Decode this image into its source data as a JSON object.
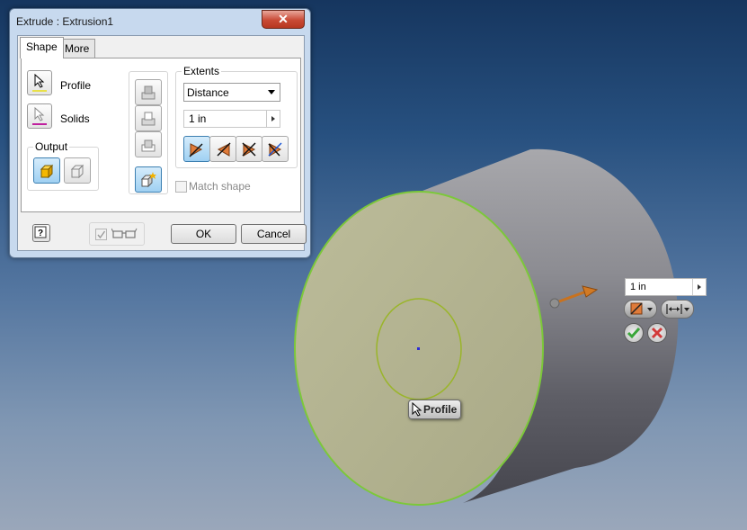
{
  "dialog": {
    "title": "Extrude : Extrusion1",
    "close_glyph": "✕",
    "tabs": [
      {
        "label": "Shape",
        "active": true
      },
      {
        "label": "More",
        "active": false
      }
    ],
    "profile_label": "Profile",
    "solids_label": "Solids",
    "output_label": "Output",
    "extents_label": "Extents",
    "extents_type": "Distance",
    "distance_value": "1 in",
    "match_shape_label": "Match shape",
    "ok_label": "OK",
    "cancel_label": "Cancel"
  },
  "viewport": {
    "distance_value": "1 in",
    "tooltip_label": "Profile"
  },
  "colors": {
    "accent_orange": "#e07b39",
    "face_color": "#b5b591",
    "edge_green": "#7cc83a",
    "ok_green": "#3aa63a",
    "cancel_red": "#d23a3a"
  }
}
